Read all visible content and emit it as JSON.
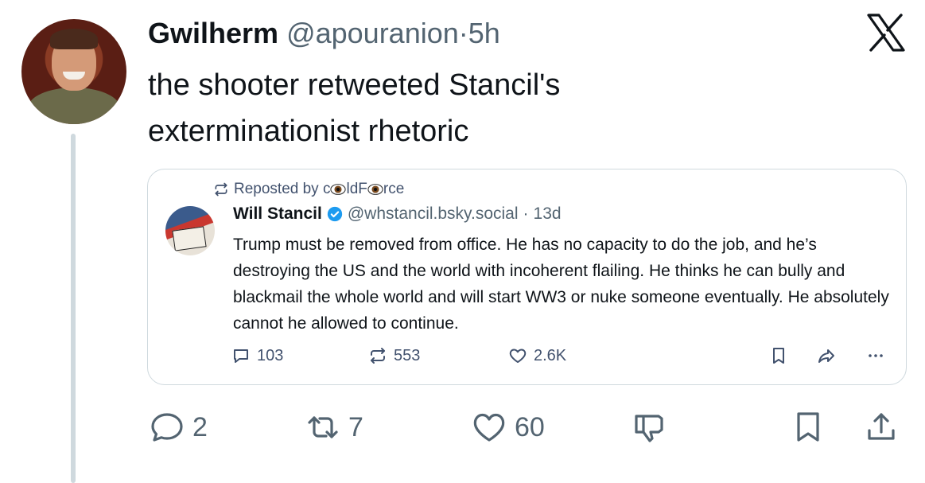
{
  "author": {
    "name": "Gwilherm",
    "handle": "@apouranion",
    "separator": "·",
    "time": "5h"
  },
  "tweet": {
    "text": "the shooter retweeted Stancil's exterminationist rhetoric"
  },
  "brand_icon": "x-logo-icon",
  "quote": {
    "repost_prefix": "Reposted by c",
    "repost_mid": "ldF",
    "repost_suffix": "rce",
    "name": "Will Stancil",
    "handle": "@whstancil.bsky.social",
    "separator": "·",
    "time": "13d",
    "text": "Trump must be removed from office. He has no capacity to do the job, and he’s destroying the US and the world with incoherent flailing. He thinks he can bully and blackmail the whole world and will start WW3 or nuke someone eventually. He absolutely cannot he allowed to continue.",
    "stats": {
      "replies": "103",
      "reposts": "553",
      "likes": "2.6K"
    },
    "accent_color": "#1d9bf0"
  },
  "actions": {
    "replies": "2",
    "reposts": "7",
    "likes": "60"
  }
}
